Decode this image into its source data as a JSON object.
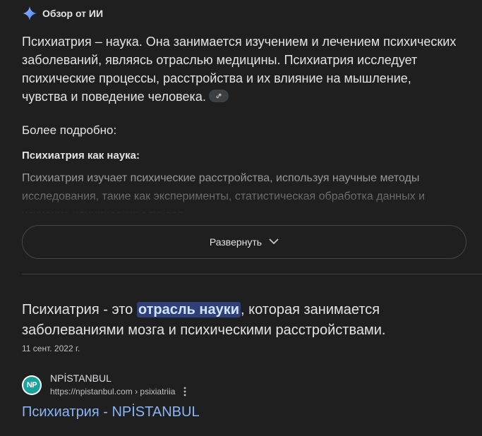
{
  "ai_overview": {
    "icon": "gemini-sparkle-icon",
    "title": "Обзор от ИИ",
    "summary": "Психиатрия – наука. Она занимается изучением и лечением психических заболеваний, являясь отраслью медицины. Психиатрия исследует психические процессы, расстройства и их влияние на мышление, чувства и поведение человека.",
    "more_heading": "Более подробно:",
    "sub_heading": "Психиатрия как наука:",
    "faded_text": "Психиатрия изучает психические расстройства, используя научные методы исследования, такие как эксперименты, статистическая обработка данных и изучение клинических случаев.",
    "expand_label": "Развернуть"
  },
  "featured_snippet": {
    "text_before": "Психиатрия - это ",
    "highlight": "отрасль науки",
    "text_after": ", которая занимается заболеваниями мозга и психическими расстройствами.",
    "date": "11 сент. 2022 г."
  },
  "result": {
    "favicon_text": "NP",
    "site_name": "NPİSTANBUL",
    "url": "https://npistanbul.com › psixiatriia",
    "title": "Психиатрия - NPİSTANBUL"
  },
  "colors": {
    "background": "#1f1f1f",
    "link": "#8ab4f8",
    "highlight_bg": "#2f3f77",
    "favicon_bg": "#1aa39a"
  }
}
